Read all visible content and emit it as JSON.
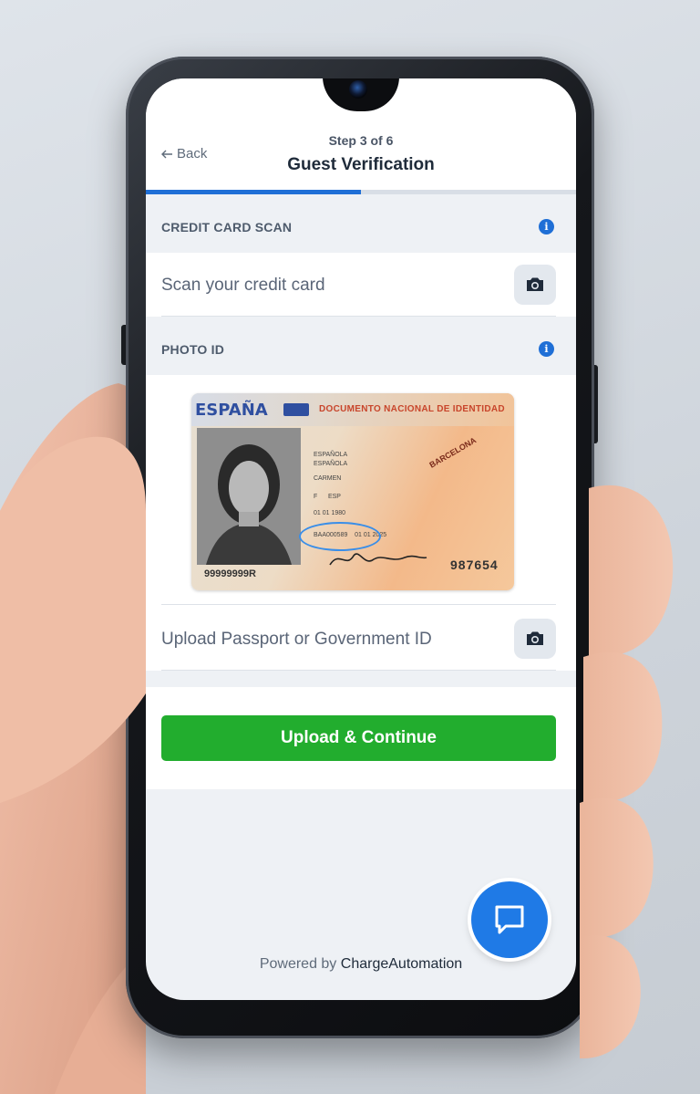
{
  "header": {
    "back_label": "Back",
    "step_label": "Step 3 of 6",
    "title": "Guest Verification",
    "progress": 0.5
  },
  "credit_card": {
    "section_label": "CREDIT CARD SCAN",
    "prompt": "Scan your credit card"
  },
  "photo_id": {
    "section_label": "PHOTO ID",
    "prompt": "Upload Passport or Government ID",
    "card": {
      "country": "ESPAÑA",
      "document": "DOCUMENTO NACIONAL DE IDENTIDAD",
      "number": "99999999R",
      "code": "987654"
    }
  },
  "cta": {
    "label": "Upload & Continue"
  },
  "footer": {
    "prefix": "Powered by",
    "brand": "ChargeAutomation"
  },
  "colors": {
    "accent": "#1f6fd6",
    "cta": "#22ad2e",
    "chat": "#1f7ae6"
  },
  "icons": {
    "back": "arrow-left-icon",
    "info": "info-icon",
    "camera": "camera-icon",
    "chat": "chat-icon"
  }
}
